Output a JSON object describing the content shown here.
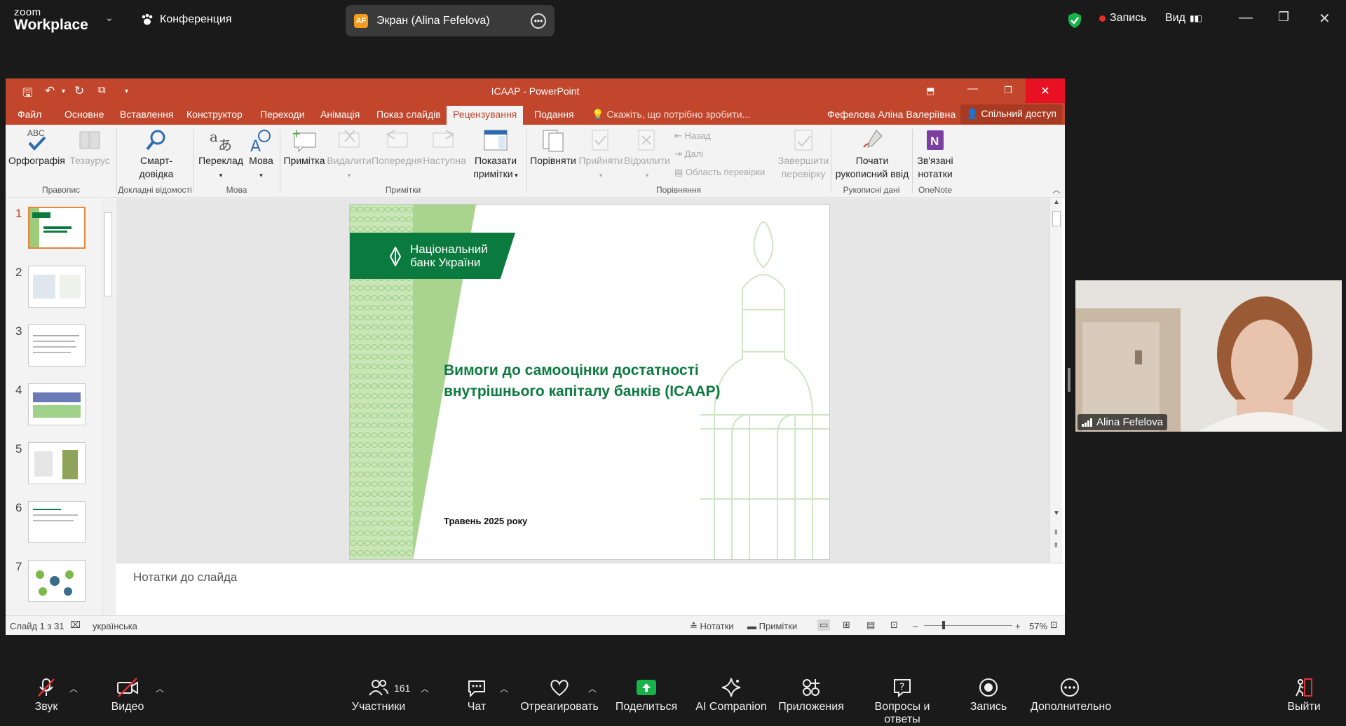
{
  "zoom": {
    "logo_small": "zoom",
    "logo_big": "Workplace",
    "conference_label": "Конференция",
    "share_user_initials": "AF",
    "share_label": "Экран (Alina Fefelova)",
    "record_label": "Запись",
    "view_label": "Вид"
  },
  "ppt": {
    "title": "ICAAP - PowerPoint",
    "user": "Фефелова Аліна Валеріївна",
    "share": "Спільний доступ",
    "search_placeholder": "Скажіть, що потрібно зробити...",
    "tabs": [
      "Файл",
      "Основне",
      "Вставлення",
      "Конструктор",
      "Переходи",
      "Анімація",
      "Показ слайдів",
      "Рецензування",
      "Подання"
    ],
    "ribbon": {
      "spell": "Орфографія",
      "thesaurus": "Тезаурус",
      "smart1": "Смарт-",
      "smart2": "довідка",
      "translate": "Переклад",
      "language": "Мова",
      "new_comment": "Примітка",
      "delete": "Видалити",
      "previous": "Попередня",
      "next": "Наступна",
      "show_comments1": "Показати",
      "show_comments2": "примітки",
      "compare": "Порівняти",
      "accept": "Прийняти",
      "reject": "Відхилити",
      "back": "Назад",
      "forward": "Далі",
      "review_pane": "Область перевірки",
      "end_review1": "Завершити",
      "end_review2": "перевірку",
      "ink1": "Почати",
      "ink2": "рукописний ввід",
      "onenote1": "Зв'язані",
      "onenote2": "нотатки",
      "abc": "ABC"
    },
    "groups": {
      "proofing": "Правопис",
      "insights": "Докладні відомості",
      "language": "Мова",
      "comments": "Примітки",
      "compare": "Порівняння",
      "ink": "Рукописні дані",
      "onenote": "OneNote"
    },
    "thumb_numbers": [
      "1",
      "2",
      "3",
      "4",
      "5",
      "6",
      "7"
    ],
    "slide": {
      "logo_line1": "Національний",
      "logo_line2": "банк України",
      "title_line1": "Вимоги до самооцінки достатності",
      "title_line2": "внутрішнього капіталу банків (ICAAP)",
      "date": "Травень 2025 року"
    },
    "notes_placeholder": "Нотатки до слайда",
    "status": {
      "slide_info": "Слайд 1 з 31",
      "language": "українська",
      "notes": "Нотатки",
      "comments": "Примітки",
      "zoom": "57%"
    }
  },
  "camera": {
    "name": "Alina Fefelova"
  },
  "bottom": {
    "audio": "Звук",
    "video": "Видео",
    "participants": "Участники",
    "participants_count": "161",
    "chat": "Чат",
    "react": "Отреагировать",
    "share": "Поделиться",
    "ai": "AI Companion",
    "apps": "Приложения",
    "qa": "Вопросы и ответы",
    "record": "Запись",
    "more": "Дополнительно",
    "leave": "Выйти"
  },
  "colors": {
    "ppt_accent": "#c2462c",
    "nbu_green": "#0b7a3e",
    "zoom_bg": "#1a1a1a"
  }
}
